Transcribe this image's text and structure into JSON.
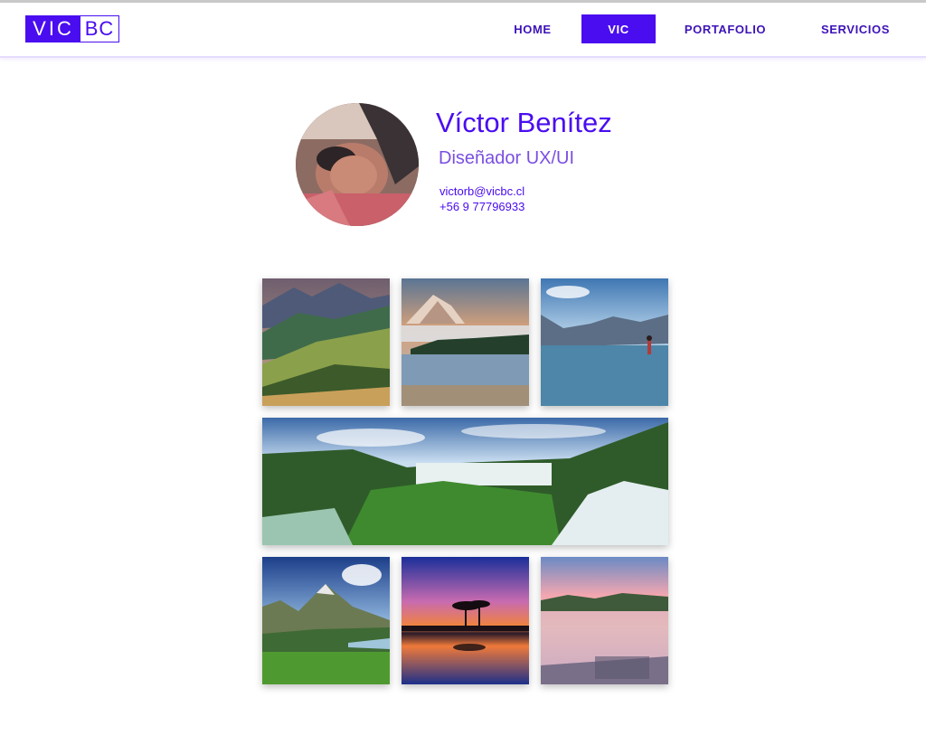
{
  "brand": {
    "logo_part1": "VIC",
    "logo_part2": "BC",
    "color": "#4a0df0"
  },
  "nav": {
    "items": [
      {
        "label": "HOME",
        "active": false
      },
      {
        "label": "VIC",
        "active": true
      },
      {
        "label": "PORTAFOLIO",
        "active": false
      },
      {
        "label": "SERVICIOS",
        "active": false
      }
    ]
  },
  "profile": {
    "name": "Víctor Benítez",
    "role": "Diseñador UX/UI",
    "email": "victorb@vicbc.cl",
    "phone": "+56 9 77796933"
  },
  "gallery": {
    "images": [
      {
        "subject": "green hills with mountains"
      },
      {
        "subject": "misty lake with mountain peak"
      },
      {
        "subject": "lake with paddleboarder"
      },
      {
        "subject": "waterfalls in jungle"
      },
      {
        "subject": "alpine mountain meadow"
      },
      {
        "subject": "sunset tree silhouette"
      },
      {
        "subject": "pink sunrise over lake"
      }
    ]
  }
}
